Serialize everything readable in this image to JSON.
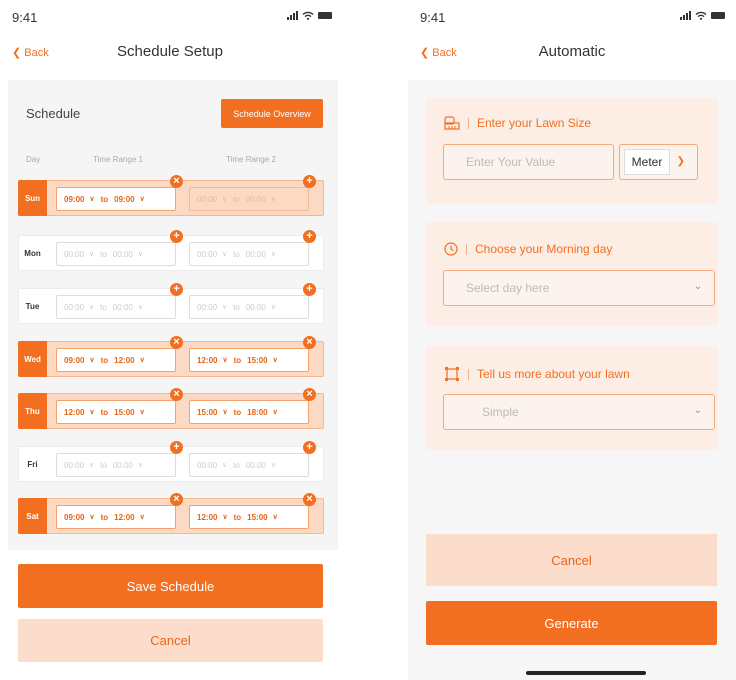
{
  "left": {
    "time": "9:41",
    "back_label": "Back",
    "title": "Schedule Setup",
    "schedule_label": "Schedule",
    "overview_label": "Schedule Overview",
    "col_day": "Day",
    "col_range1": "Time Range 1",
    "col_range2": "Time Range 2",
    "to_word": "to",
    "days": [
      {
        "label": "Sun",
        "from1": "09:00",
        "to1": "09:00",
        "from2": "00:00",
        "to2": "00:00"
      },
      {
        "label": "Mon",
        "from1": "00:00",
        "to1": "00:00",
        "from2": "00:00",
        "to2": "00:00"
      },
      {
        "label": "Tue",
        "from1": "00:00",
        "to1": "00:00",
        "from2": "00:00",
        "to2": "00:00"
      },
      {
        "label": "Wed",
        "from1": "09:00",
        "to1": "12:00",
        "from2": "12:00",
        "to2": "15:00"
      },
      {
        "label": "Thu",
        "from1": "12:00",
        "to1": "15:00",
        "from2": "15:00",
        "to2": "18:00"
      },
      {
        "label": "Fri",
        "from1": "00:00",
        "to1": "00:00",
        "from2": "00:00",
        "to2": "00:00"
      },
      {
        "label": "Sat",
        "from1": "09:00",
        "to1": "12:00",
        "from2": "12:00",
        "to2": "15:00"
      }
    ],
    "save_label": "Save Schedule",
    "cancel_label": "Cancel"
  },
  "right": {
    "time": "9:41",
    "back_label": "Back",
    "title": "Automatic",
    "lawn_size_title": "Enter your Lawn Size",
    "lawn_size_placeholder": "Enter Your Value",
    "unit_value": "Meter",
    "morning_title": "Choose your Morning day",
    "morning_placeholder": "Select day here",
    "lawn_more_title": "Tell us more about your lawn",
    "lawn_type_value": "Simple",
    "cancel_label": "Cancel",
    "generate_label": "Generate"
  },
  "colors": {
    "accent": "#f26f21",
    "accent_light": "#fcdccb"
  }
}
